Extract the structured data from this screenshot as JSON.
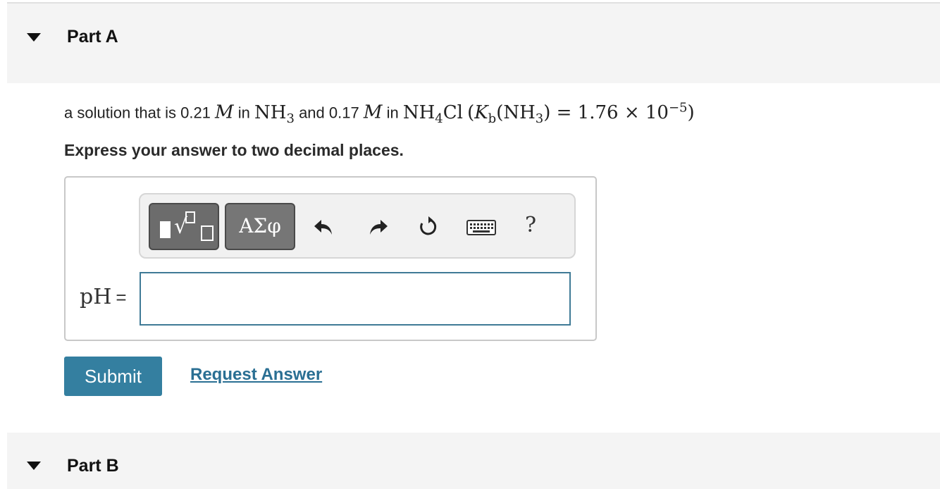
{
  "partA": {
    "title": "Part A"
  },
  "partB": {
    "title": "Part B"
  },
  "question": {
    "text1": "a solution that is 0.21",
    "M": "M",
    "in1": "in",
    "nh3_base": "NH",
    "nh3_sub": "3",
    "and": "and 0.17",
    "in2": "in",
    "nh4cl_base": "NH",
    "nh4cl_sub": "4",
    "nh4cl_tail": "Cl",
    "kb_open": "(",
    "K": "K",
    "kb_sub": "b",
    "kb_nh3": "(NH",
    "kb_nh3_sub": "3",
    "kb_rest": ") = 1.76 × 10",
    "kb_exp": "−5",
    "kb_close": ")"
  },
  "instruction": "Express your answer to two decimal places.",
  "toolbar": {
    "greek_label": "ΑΣφ",
    "help_label": "?"
  },
  "answer": {
    "label": "pH",
    "equals": "=",
    "value": ""
  },
  "actions": {
    "submit_label": "Submit",
    "request_label": "Request Answer"
  }
}
